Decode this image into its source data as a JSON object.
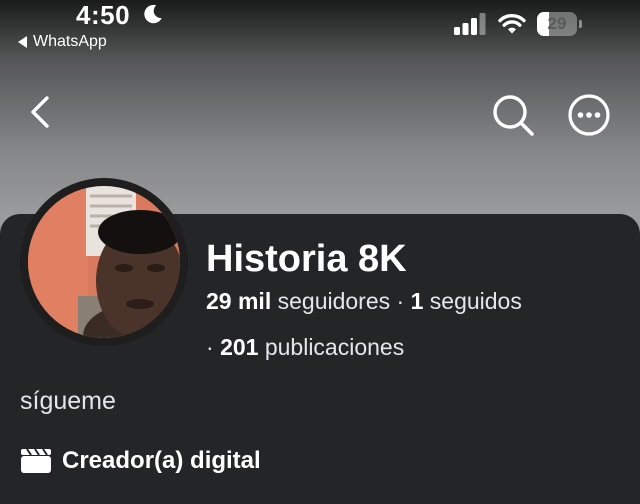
{
  "status_bar": {
    "time": "4:50",
    "back_app": "WhatsApp",
    "battery_level": "29",
    "battery_fraction": 0.29,
    "icons": [
      "moon-icon",
      "cellular-signal-icon",
      "wifi-icon",
      "battery-icon"
    ]
  },
  "nav": {
    "icons": [
      "back-arrow-icon",
      "search-icon",
      "more-options-icon"
    ]
  },
  "profile": {
    "name": "Historia 8K",
    "followers_count": "29 mil",
    "followers_label": "seguidores",
    "following_count": "1",
    "following_label": "seguidos",
    "separator": "·",
    "posts_count": "201",
    "posts_label": "publicaciones",
    "bio": "sígueme",
    "category": "Creador(a) digital",
    "category_icon": "clapperboard-icon"
  },
  "colors": {
    "card_background": "#242526",
    "text_primary": "#ffffff",
    "text_secondary": "#e4e6eb"
  }
}
